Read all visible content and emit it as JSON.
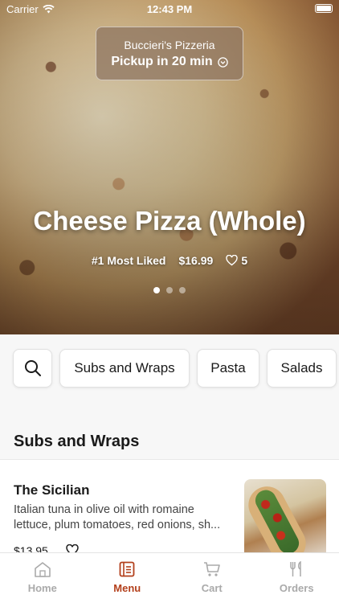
{
  "status_bar": {
    "carrier": "Carrier",
    "time": "12:43 PM"
  },
  "store": {
    "name": "Buccieri's Pizzeria",
    "pickup": "Pickup in 20 min"
  },
  "hero": {
    "title": "Cheese Pizza (Whole)",
    "rank": "#1 Most Liked",
    "price": "$16.99",
    "likes": "5",
    "carousel_pages": 3,
    "carousel_active_index": 0
  },
  "categories": [
    "Subs and Wraps",
    "Pasta",
    "Salads"
  ],
  "section": {
    "title": "Subs and Wraps"
  },
  "item": {
    "name": "The Sicilian",
    "description": "Italian tuna in olive oil with romaine lettuce, plum tomatoes, red onions, sh...",
    "price": "$13.95"
  },
  "tabs": [
    {
      "label": "Home",
      "icon": "home-icon"
    },
    {
      "label": "Menu",
      "icon": "menu-icon"
    },
    {
      "label": "Cart",
      "icon": "cart-icon"
    },
    {
      "label": "Orders",
      "icon": "orders-icon"
    }
  ],
  "active_tab": "Menu",
  "colors": {
    "accent": "#b3401c",
    "inactive": "#aaaaaa"
  }
}
